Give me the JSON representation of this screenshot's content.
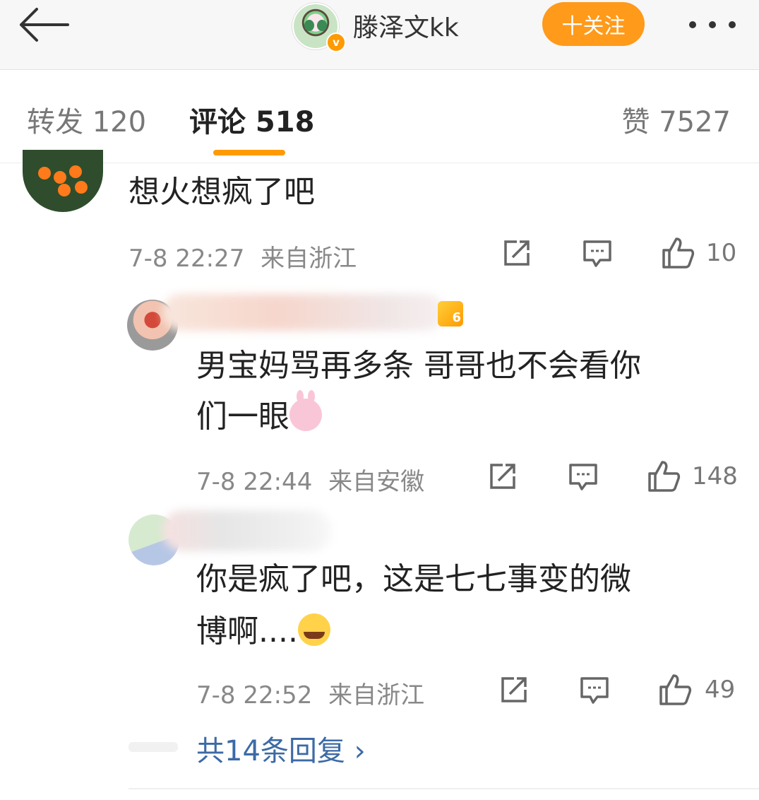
{
  "header": {
    "username": "滕泽文kk",
    "follow_label": "十关注",
    "verified_badge": "v"
  },
  "tabs": {
    "repost": "转发 120",
    "comment": "评论 518",
    "like": "赞 7527"
  },
  "comments": [
    {
      "text": "想火想疯了吧",
      "time": "7-8 22:27",
      "location": "来自浙江",
      "likes": "10"
    },
    {
      "text_line1": "男宝妈骂再多条 哥哥也不会看你",
      "text_line2": "们一眼",
      "time": "7-8 22:44",
      "location": "来自安徽",
      "likes": "148",
      "level": "6"
    },
    {
      "text_line1": "你是疯了吧，这是七七事变的微",
      "text_line2": "博啊....",
      "time": "7-8 22:52",
      "location": "来自浙江",
      "likes": "49"
    }
  ],
  "replies_link": "共14条回复 ›",
  "colors": {
    "accent_orange": "#ff9a00",
    "link_blue": "#3c6aa5",
    "meta_gray": "#888888"
  },
  "icons": [
    "back-arrow-icon",
    "more-dots-icon",
    "share-icon",
    "comment-icon",
    "like-thumb-icon"
  ]
}
